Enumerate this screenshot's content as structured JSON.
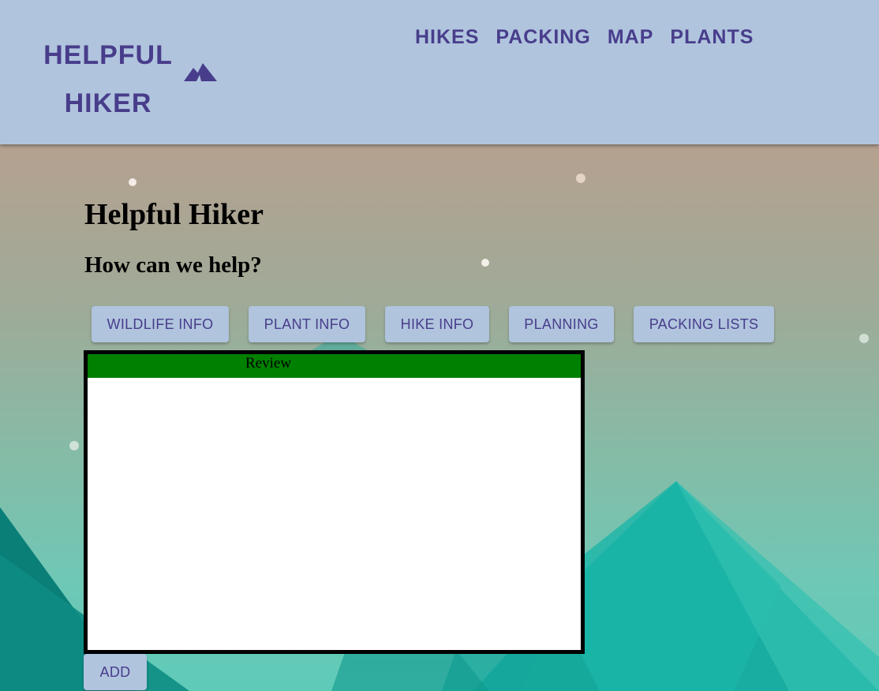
{
  "header": {
    "logo_line1": "HELPFUL",
    "logo_line2": "HIKER",
    "logo_icon": "mountain-icon",
    "nav": [
      "HIKES",
      "PACKING",
      "MAP",
      "PLANTS"
    ]
  },
  "main": {
    "title": "Helpful Hiker",
    "subtitle": "How can we help?",
    "buttons": [
      "WILDLIFE INFO",
      "PLANT INFO",
      "HIKE INFO",
      "PLANNING",
      "PACKING LISTS"
    ],
    "review_header": "Review",
    "add_button": "ADD"
  },
  "colors": {
    "header_bg": "#b0c4de",
    "accent": "#483d8b",
    "review_header_bg": "#008000"
  }
}
